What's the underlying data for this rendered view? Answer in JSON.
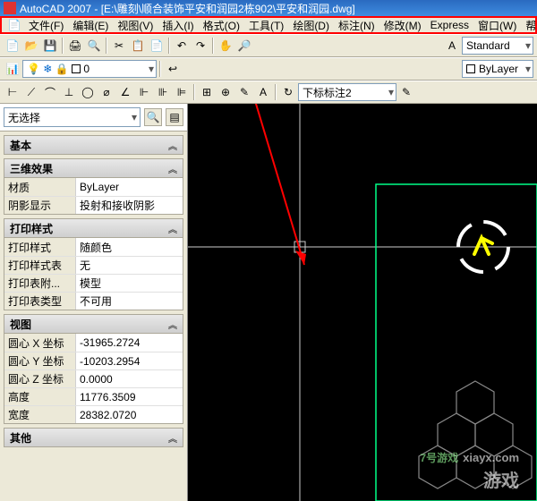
{
  "title_bar": {
    "app_icon": "autocad-icon",
    "text": "AutoCAD 2007 - [E:\\雕刻\\顺合装饰平安和润园2栋902\\平安和润园.dwg]"
  },
  "menu": {
    "file_icon": "doc-icon",
    "items": [
      "文件(F)",
      "编辑(E)",
      "视图(V)",
      "插入(I)",
      "格式(O)",
      "工具(T)",
      "绘图(D)",
      "标注(N)",
      "修改(M)",
      "Express",
      "窗口(W)",
      "帮助(H)"
    ]
  },
  "toolbar_top": {
    "style_dropdown": "Standard",
    "layer_dropdown": "ByLayer"
  },
  "toolbar_dim": {
    "dim_style": "下标标注2"
  },
  "sidebar": {
    "selection": {
      "value": "无选择"
    },
    "sections": [
      {
        "title": "基本",
        "collapsed": true,
        "rows": []
      },
      {
        "title": "三维效果",
        "collapsed": false,
        "rows": [
          {
            "label": "材质",
            "value": "ByLayer"
          },
          {
            "label": "阴影显示",
            "value": "投射和接收阴影"
          }
        ]
      },
      {
        "title": "打印样式",
        "collapsed": false,
        "rows": [
          {
            "label": "打印样式",
            "value": "随颜色"
          },
          {
            "label": "打印样式表",
            "value": "无"
          },
          {
            "label": "打印表附...",
            "value": "模型"
          },
          {
            "label": "打印表类型",
            "value": "不可用"
          }
        ]
      },
      {
        "title": "视图",
        "collapsed": false,
        "rows": [
          {
            "label": "圆心 X 坐标",
            "value": "-31965.2724"
          },
          {
            "label": "圆心 Y 坐标",
            "value": "-10203.2954"
          },
          {
            "label": "圆心 Z 坐标",
            "value": "0.0000"
          },
          {
            "label": "高度",
            "value": "11776.3509"
          },
          {
            "label": "宽度",
            "value": "28382.0720"
          }
        ]
      },
      {
        "title": "其他",
        "collapsed": true,
        "rows": []
      }
    ]
  },
  "watermark": {
    "logo_text": "7号游戏",
    "url": "xiayx.com",
    "sub": "游戏"
  }
}
